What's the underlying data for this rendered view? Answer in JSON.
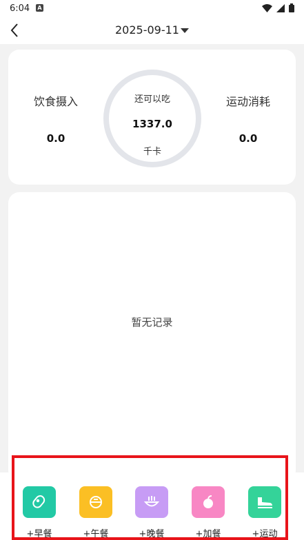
{
  "status_bar": {
    "time": "6:04",
    "notif_glyph": "A"
  },
  "nav": {
    "date": "2025-09-11"
  },
  "summary": {
    "intake_label": "饮食摄入",
    "intake_value": "0.0",
    "remaining_label": "还可以吃",
    "remaining_value": "1337.0",
    "remaining_unit": "千卡",
    "burn_label": "运动消耗",
    "burn_value": "0.0"
  },
  "records": {
    "empty_text": "暂无记录"
  },
  "actions": [
    {
      "label": "+早餐",
      "icon": "breakfast-icon",
      "color": "#22c9a5"
    },
    {
      "label": "+午餐",
      "icon": "lunch-icon",
      "color": "#fbbf24"
    },
    {
      "label": "+晚餐",
      "icon": "dinner-icon",
      "color": "#c79cf5"
    },
    {
      "label": "+加餐",
      "icon": "snack-icon",
      "color": "#f887c4"
    },
    {
      "label": "+运动",
      "icon": "exercise-icon",
      "color": "#34d399"
    }
  ],
  "colors": {
    "highlight": "#e8141a",
    "ring": "#e3e5ea",
    "background": "#f2f2f2"
  }
}
